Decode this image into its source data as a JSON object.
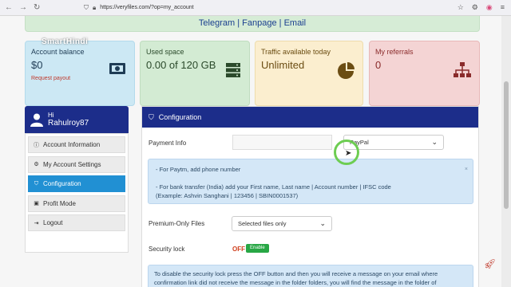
{
  "browser": {
    "url": "https://veryfiles.com/?op=my_account",
    "icons": [
      "back-icon",
      "forward-icon",
      "reload-icon",
      "shield-icon",
      "lock-icon",
      "bookmark-icon",
      "extensions-icon",
      "firefox-account-icon",
      "menu-icon"
    ]
  },
  "banner": {
    "links": [
      "Telegram",
      "Fanpage",
      "Email"
    ],
    "separator": "|"
  },
  "watermark": "SmartHindi",
  "cards": {
    "balance": {
      "label": "Account balance",
      "value": "$0",
      "action": "Request payout"
    },
    "space": {
      "label": "Used space",
      "value": "0.00 of 120 GB"
    },
    "traffic": {
      "label": "Traffic available today",
      "value": "Unlimited"
    },
    "referrals": {
      "label": "My referrals",
      "value": "0"
    }
  },
  "user": {
    "greeting": "Hi",
    "name": "Rahulroy87"
  },
  "menu": {
    "items": [
      {
        "label": "Account Information",
        "icon": "info-icon"
      },
      {
        "label": "My Account Settings",
        "icon": "gear-icon"
      },
      {
        "label": "Configuration",
        "icon": "shield-icon",
        "active": true
      },
      {
        "label": "Profit Mode",
        "icon": "money-icon"
      },
      {
        "label": "Logout",
        "icon": "logout-icon"
      }
    ]
  },
  "config": {
    "title": "Configuration",
    "payment": {
      "label": "Payment Info",
      "value": "",
      "method": "PayPal"
    },
    "note": {
      "line1": "- For Paytm, add phone number",
      "line2": "- For bank transfer (India) add your First name, Last name | Account number | IFSC code",
      "line3": "(Example: Ashvin Sanghani | 123456 | SBIN0001537)",
      "close": "×"
    },
    "premium": {
      "label": "Premium-Only Files",
      "value": "Selected files only"
    },
    "security": {
      "label": "Security lock",
      "state": "OFF",
      "button": "Enable"
    },
    "lock_info": "To disable the security lock press the OFF button and then you will receive a message on your email where confirmation link did not receive the message in the folder folders, you will find the message in the folder of"
  },
  "colors": {
    "header": "#1c2d8a",
    "active": "#2190d3",
    "link": "#1a3f8f",
    "enable": "#28a745",
    "off": "#d0401e"
  }
}
